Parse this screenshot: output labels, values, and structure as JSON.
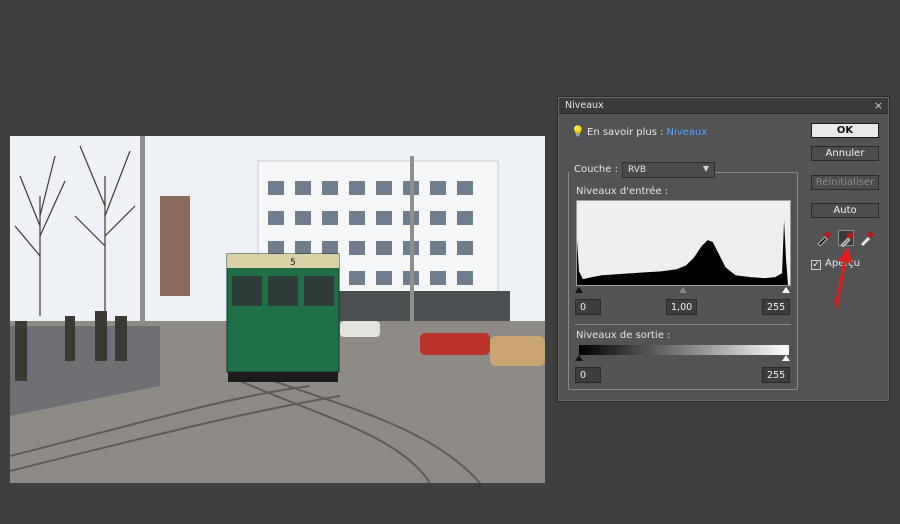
{
  "dialog": {
    "title": "Niveaux",
    "learn_prefix": "En savoir plus :",
    "learn_link": "Niveaux",
    "channel_label": "Couche :",
    "channel_value": "RVB",
    "input_label": "Niveaux d'entrée :",
    "input_black": "0",
    "input_gamma": "1,00",
    "input_white": "255",
    "output_label": "Niveaux de sortie :",
    "output_black": "0",
    "output_white": "255",
    "buttons": {
      "ok": "OK",
      "cancel": "Annuler",
      "reset": "Réinitialiser",
      "auto": "Auto"
    },
    "preview_label": "Aperçu",
    "preview_checked": true,
    "eyedroppers": [
      "black-eyedropper-icon",
      "gray-eyedropper-icon",
      "white-eyedropper-icon"
    ]
  },
  "photo": {
    "tram_number": "5"
  },
  "colors": {
    "background": "#3f3f3f",
    "dialog": "#535353",
    "link": "#4fa3ff",
    "annotation": "#e31b1b",
    "tram_green": "#1f6f47"
  }
}
